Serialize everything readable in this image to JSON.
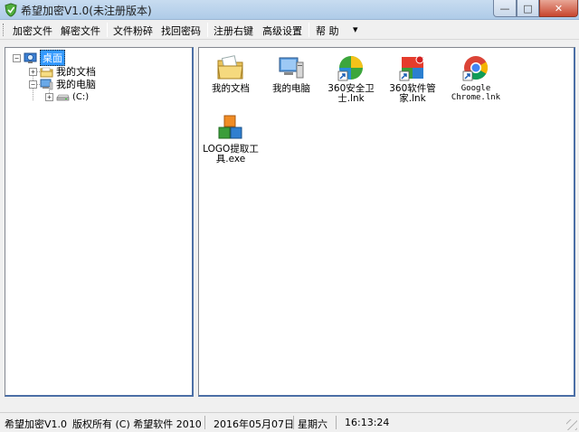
{
  "window": {
    "title": "希望加密V1.0(未注册版本)",
    "minimize_symbol": "—",
    "maximize_symbol": "□",
    "close_symbol": "✕"
  },
  "menu": {
    "items": [
      "加密文件",
      "解密文件",
      "文件粉碎",
      "找回密码",
      "注册右键",
      "高级设置",
      "帮 助"
    ],
    "dropdown_symbol": "▾"
  },
  "tree": {
    "expand_symbol": "+",
    "collapse_symbol": "−",
    "nodes": [
      {
        "label": "桌面",
        "icon": "desktop-icon",
        "selected": true
      },
      {
        "label": "我的文档",
        "icon": "folder-icon"
      },
      {
        "label": "我的电脑",
        "icon": "computer-icon"
      },
      {
        "label": "(C:)",
        "icon": "drive-icon"
      }
    ]
  },
  "files": [
    {
      "label": "我的文档",
      "icon": "documents-folder-icon"
    },
    {
      "label": "我的电脑",
      "icon": "computer-icon"
    },
    {
      "label": "360安全卫士.lnk",
      "icon": "360-security-icon"
    },
    {
      "label": "360软件管家.lnk",
      "icon": "360-software-manager-icon"
    },
    {
      "label": "Google Chrome.lnk",
      "icon": "chrome-icon"
    },
    {
      "label": "LOGO提取工具.exe",
      "icon": "logo-tool-icon"
    }
  ],
  "status": {
    "app": "希望加密V1.0",
    "copyright": "版权所有 (C) 希望软件 2010",
    "date": "2016年05月07日",
    "weekday": "星期六",
    "time": "16:13:24"
  },
  "colors": {
    "selection": "#3399ff",
    "panel_border": "#4b6fa6",
    "close_button": "#c8462e"
  }
}
